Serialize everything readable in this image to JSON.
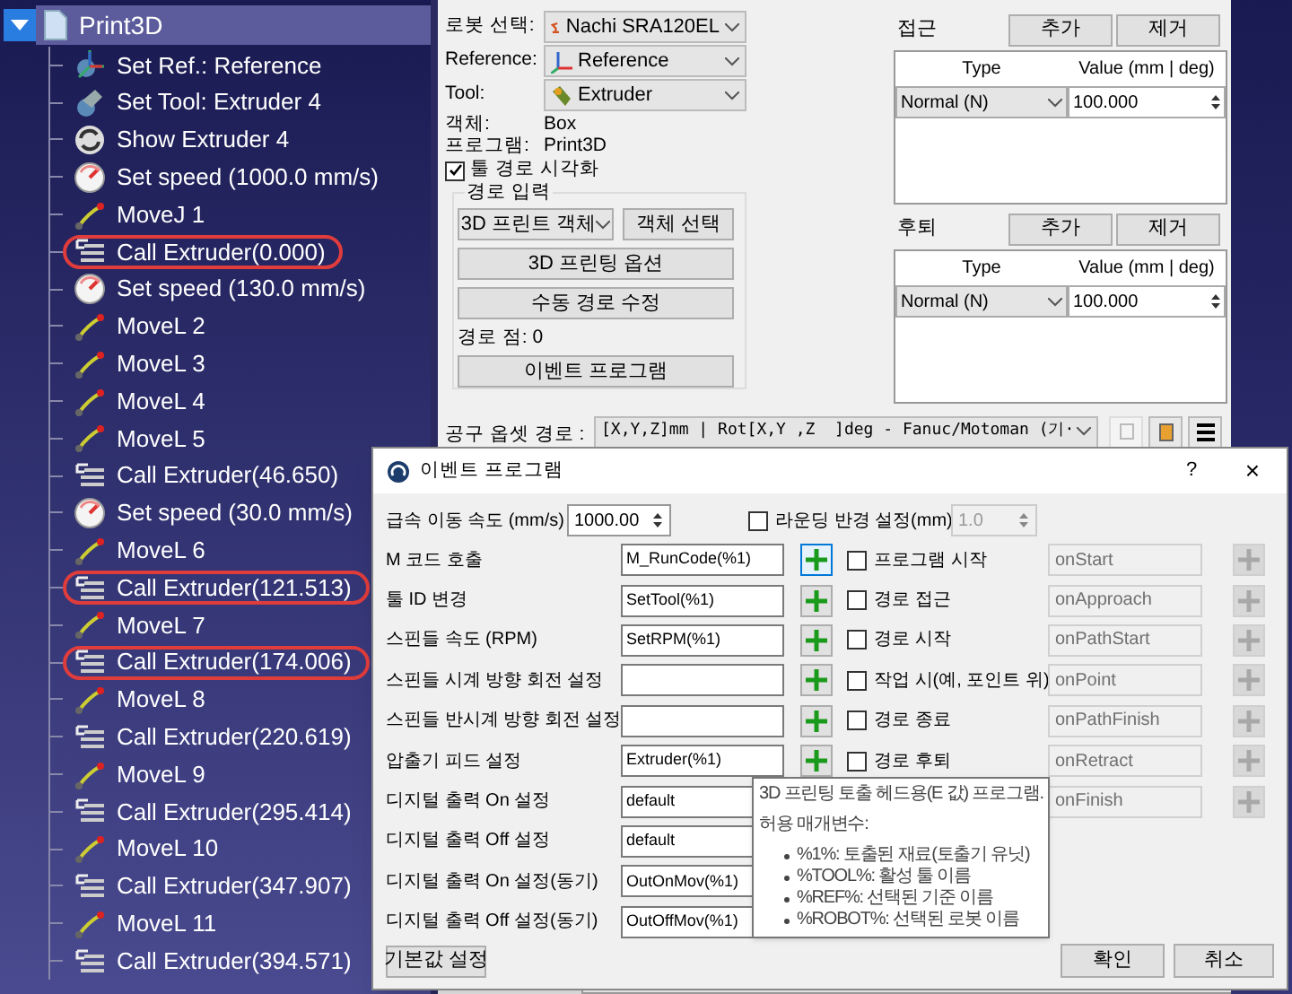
{
  "tree": {
    "label": "Print3D",
    "expanded": true,
    "selected": true,
    "children": [
      {
        "label": "Set Ref.: Reference",
        "kind": "reference",
        "circled": false
      },
      {
        "label": "Set Tool: Extruder 4",
        "kind": "tool",
        "circled": false
      },
      {
        "label": "Show Extruder 4",
        "kind": "show",
        "circled": false
      },
      {
        "label": "Set speed (1000.0 mm/s)",
        "kind": "speed",
        "circled": false
      },
      {
        "label": "MoveJ 1",
        "kind": "move",
        "circled": false
      },
      {
        "label": "Call Extruder(0.000)",
        "kind": "call",
        "circled": true
      },
      {
        "label": "Set speed (130.0 mm/s)",
        "kind": "speed",
        "circled": false
      },
      {
        "label": "MoveL 2",
        "kind": "move",
        "circled": false
      },
      {
        "label": "MoveL 3",
        "kind": "move",
        "circled": false
      },
      {
        "label": "MoveL 4",
        "kind": "move",
        "circled": false
      },
      {
        "label": "MoveL 5",
        "kind": "move",
        "circled": false
      },
      {
        "label": "Call Extruder(46.650)",
        "kind": "call",
        "circled": false
      },
      {
        "label": "Set speed (30.0 mm/s)",
        "kind": "speed",
        "circled": false
      },
      {
        "label": "MoveL 6",
        "kind": "move",
        "circled": false
      },
      {
        "label": "Call Extruder(121.513)",
        "kind": "call",
        "circled": true
      },
      {
        "label": "MoveL 7",
        "kind": "move",
        "circled": false
      },
      {
        "label": "Call Extruder(174.006)",
        "kind": "call",
        "circled": true
      },
      {
        "label": "MoveL 8",
        "kind": "move",
        "circled": false
      },
      {
        "label": "Call Extruder(220.619)",
        "kind": "call",
        "circled": false
      },
      {
        "label": "MoveL 9",
        "kind": "move",
        "circled": false
      },
      {
        "label": "Call Extruder(295.414)",
        "kind": "call",
        "circled": false
      },
      {
        "label": "MoveL 10",
        "kind": "move",
        "circled": false
      },
      {
        "label": "Call Extruder(347.907)",
        "kind": "call",
        "circled": false
      },
      {
        "label": "MoveL 11",
        "kind": "move",
        "circled": false
      },
      {
        "label": "Call Extruder(394.571)",
        "kind": "call",
        "circled": false
      }
    ]
  },
  "settings": {
    "fields": [
      {
        "label": "로봇 선택:",
        "value": "Nachi SRA120EL",
        "kind": "robot"
      },
      {
        "label": "Reference:",
        "value": "Reference",
        "kind": "reference"
      },
      {
        "label": "Tool:",
        "value": "Extruder",
        "kind": "tool"
      }
    ],
    "info": [
      {
        "label": "객체:",
        "value": "Box"
      },
      {
        "label": "프로그램:",
        "value": "Print3D"
      }
    ],
    "visualize": {
      "label": "툴 경로 시각화",
      "checked": true
    },
    "path_input": {
      "title": "경로 입력",
      "object_type": "3D 프린트 객체",
      "select_button": "객체 선택",
      "options_button": "3D 프린팅 옵션",
      "edit_button": "수동 경로 수정",
      "points": "경로 점: 0",
      "event_button": "이벤트 프로그램"
    },
    "motions": [
      {
        "title": "접근",
        "add": "추가",
        "remove": "제거",
        "columns": [
          "Type",
          "Value (mm | deg)"
        ],
        "type": "Normal (N)",
        "value": "100.000"
      },
      {
        "title": "후퇴",
        "add": "추가",
        "remove": "제거",
        "columns": [
          "Type",
          "Value (mm | deg)"
        ],
        "type": "Normal (N)",
        "value": "100.000"
      }
    ],
    "tool_offset": {
      "label": "공구 옵셋 경로 :",
      "value": "[X,Y,Z]mm | Rot[X,Y ,Z  ]deg - Fanuc/Motoman (기·"
    }
  },
  "dialog": {
    "title": "이벤트 프로그램",
    "help": "?",
    "close": "×",
    "rapid": {
      "label": "급속 이동 속도 (mm/s)",
      "value": "1000.00"
    },
    "rounding": {
      "label": "라운딩 반경 설정(mm)",
      "checked": false,
      "value": "1.0"
    },
    "left_rows": [
      {
        "label": "M 코드 호출",
        "value": "M_RunCode(%1)",
        "focused": true
      },
      {
        "label": "툴 ID 변경",
        "value": "SetTool(%1)",
        "focused": false
      },
      {
        "label": "스핀들 속도 (RPM)",
        "value": "SetRPM(%1)",
        "focused": false
      },
      {
        "label": "스핀들 시계 방향 회전 설정",
        "value": "",
        "focused": false
      },
      {
        "label": "스핀들 반시계 방향 회전 설정",
        "value": "",
        "focused": false
      },
      {
        "label": "압출기 피드 설정",
        "value": "Extruder(%1)",
        "focused": false
      },
      {
        "label": "디지털 출력 On 설정",
        "value": "default"
      },
      {
        "label": "디지털 출력 Off 설정",
        "value": "default"
      },
      {
        "label": "디지털 출력 On 설정(동기)",
        "value": "OutOnMov(%1)"
      },
      {
        "label": "디지털 출력 Off 설정(동기)",
        "value": "OutOffMov(%1)"
      }
    ],
    "right_rows": [
      {
        "label": "프로그램 시작",
        "checked": false,
        "value": "onStart"
      },
      {
        "label": "경로 접근",
        "checked": false,
        "value": "onApproach"
      },
      {
        "label": "경로 시작",
        "checked": false,
        "value": "onPathStart"
      },
      {
        "label": "작업 시(예, 포인트 위)",
        "checked": false,
        "value": "onPoint"
      },
      {
        "label": "경로 종료",
        "checked": false,
        "value": "onPathFinish"
      },
      {
        "label": "경로 후퇴",
        "checked": false,
        "value": "onRetract"
      },
      {
        "checked": false,
        "value": "onFinish"
      }
    ],
    "tooltip": {
      "lines": [
        "3D 프린팅 토출 헤드용(E 값) 프로그램.",
        "허용 매개변수:"
      ],
      "bullets": [
        "%1%: 토출된 재료(토출기 유닛)",
        "%TOOL%: 활성 툴 이름",
        "%REF%: 선택된 기준 이름",
        "%ROBOT%: 선택된 로봇 이름"
      ]
    },
    "defaults_button": "기본값 설정",
    "ok": "확인",
    "cancel": "취소"
  }
}
